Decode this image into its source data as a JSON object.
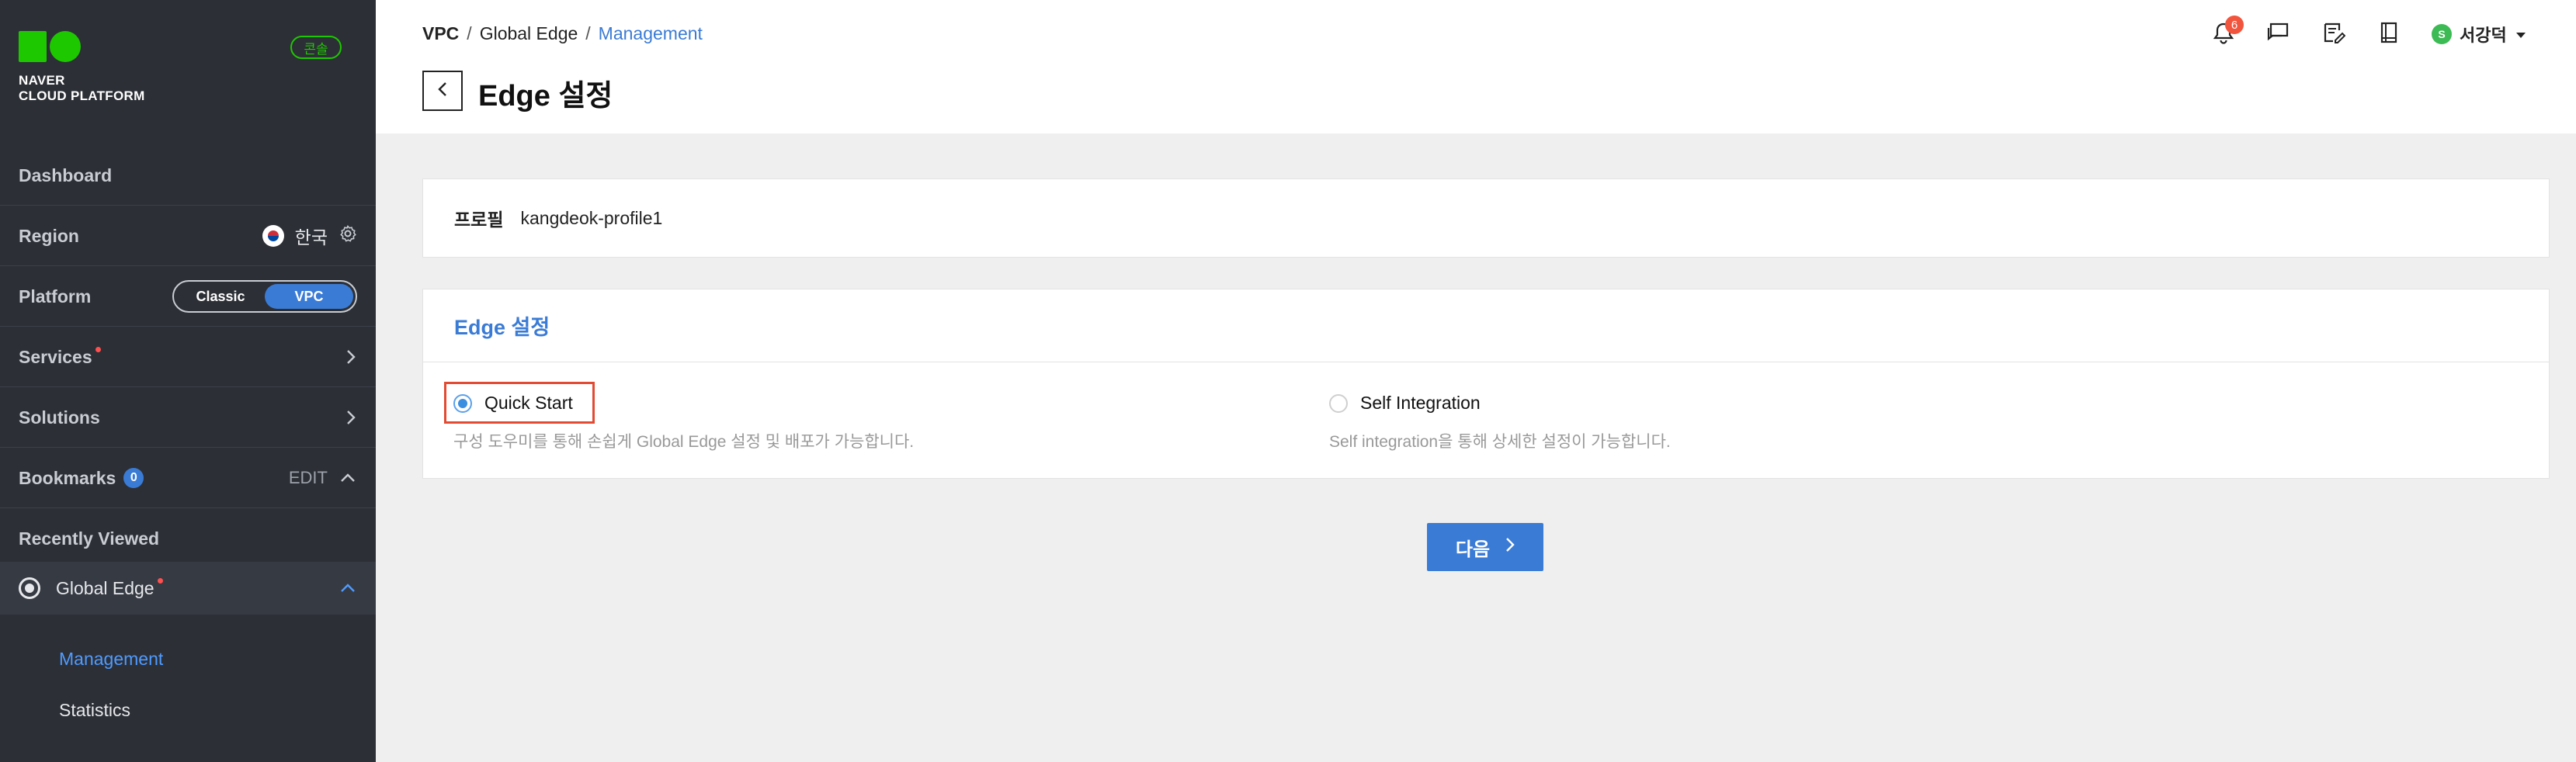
{
  "sidebar": {
    "logo_line1": "NAVER",
    "logo_line2": "CLOUD PLATFORM",
    "console_badge": "콘솔",
    "dashboard": "Dashboard",
    "region": {
      "label": "Region",
      "value": "한국"
    },
    "platform": {
      "label": "Platform",
      "options": [
        "Classic",
        "VPC"
      ],
      "selected": "VPC"
    },
    "services": "Services",
    "solutions": "Solutions",
    "bookmarks": {
      "label": "Bookmarks",
      "count": "0",
      "edit": "EDIT"
    },
    "recently_viewed": "Recently Viewed",
    "global_edge": "Global Edge",
    "sub_items": [
      "Management",
      "Statistics"
    ]
  },
  "header": {
    "breadcrumb": [
      "VPC",
      "Global Edge",
      "Management"
    ],
    "title": "Edge 설정",
    "notification_count": "6",
    "user_initial": "S",
    "user_name": "서강덕"
  },
  "profile": {
    "label": "프로필",
    "value": "kangdeok-profile1"
  },
  "edge_settings": {
    "title": "Edge 설정",
    "options": [
      {
        "label": "Quick Start",
        "description": "구성 도우미를 통해 손쉽게 Global Edge 설정 및 배포가 가능합니다.",
        "selected": true
      },
      {
        "label": "Self Integration",
        "description": "Self integration을 통해 상세한 설정이 가능합니다.",
        "selected": false
      }
    ]
  },
  "next_button": "다음",
  "colors": {
    "accent": "#3a7bd5",
    "brand_green": "#1ec800",
    "highlight": "#e24a34",
    "sidebar_bg": "#2c2f36"
  }
}
